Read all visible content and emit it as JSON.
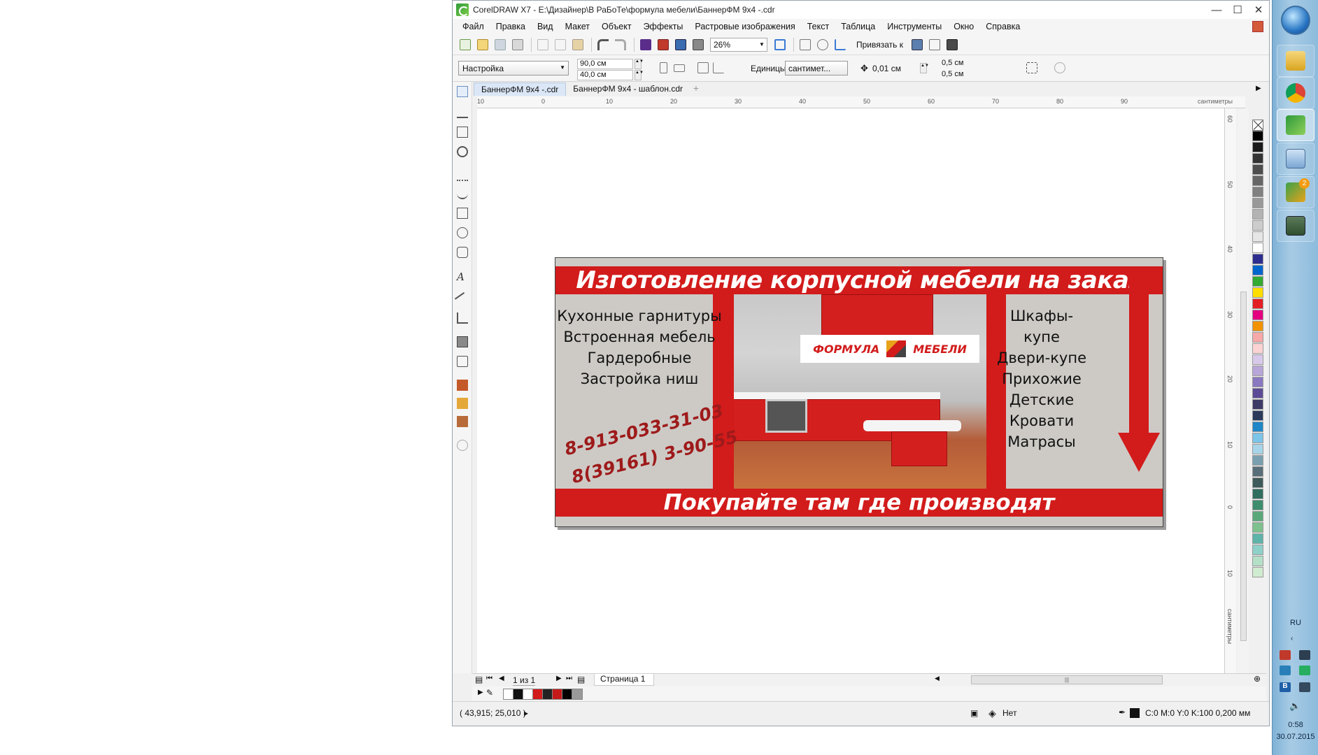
{
  "window": {
    "title": "CorelDRAW X7 - E:\\Дизайнер\\В РаБоТе\\формула мебели\\БаннерФМ 9x4 -.cdr",
    "minimize": "—",
    "maximize": "☐",
    "close": "✕"
  },
  "menu": [
    "Файл",
    "Правка",
    "Вид",
    "Макет",
    "Объект",
    "Эффекты",
    "Растровые изображения",
    "Текст",
    "Таблица",
    "Инструменты",
    "Окно",
    "Справка"
  ],
  "toolbar": {
    "zoom": "26%",
    "snap_label": "Привязать к"
  },
  "propbar": {
    "preset": "Настройка",
    "width": "90,0 см",
    "height": "40,0 см",
    "units_label": "Единицы:",
    "units_value": "сантимет...",
    "nudge": "0,01 см",
    "dup_x": "0,5 см",
    "dup_y": "0,5 см"
  },
  "tabs": [
    "БаннерФМ 9x4 -.cdr",
    "БаннерФМ 9x4 - шаблон.cdr"
  ],
  "ruler": {
    "h_ticks": [
      "10",
      "0",
      "10",
      "20",
      "30",
      "40",
      "50",
      "60",
      "70",
      "80",
      "90"
    ],
    "h_unit": "сантиметры",
    "v_ticks": [
      "60",
      "50",
      "40",
      "30",
      "20",
      "10",
      "0",
      "10"
    ],
    "v_unit": "сантиметры"
  },
  "banner": {
    "headline": "Изготовление корпусной мебели на заказ",
    "left_list": [
      "Кухонные гарнитуры",
      "Встроенная мебель",
      "Гардеробные",
      "Застройка ниш"
    ],
    "right_list": [
      "Шкафы-купе",
      "Двери-купе",
      "Прихожие",
      "Детские",
      "Кровати",
      "Матрасы"
    ],
    "phone1": "8-913-033-31-03",
    "phone2": "8(39161) 3-90-55",
    "logo_left": "ФОРМУЛА",
    "logo_right": "МЕБЕЛИ",
    "footer": "Покупайте там где производят",
    "colors": {
      "red": "#d21b1b",
      "phone": "#9e1a1a"
    }
  },
  "pagebar": {
    "page_counter": "1 из 1",
    "page_tab": "Страница 1"
  },
  "status": {
    "coords": "( 43,915; 25,010 )",
    "fill": "Нет",
    "outline": "C:0 M:0 Y:0 K:100  0,200 мм"
  },
  "taskbar": {
    "lang": "RU",
    "time": "0:58",
    "date": "30.07.2015",
    "badge": "2"
  }
}
